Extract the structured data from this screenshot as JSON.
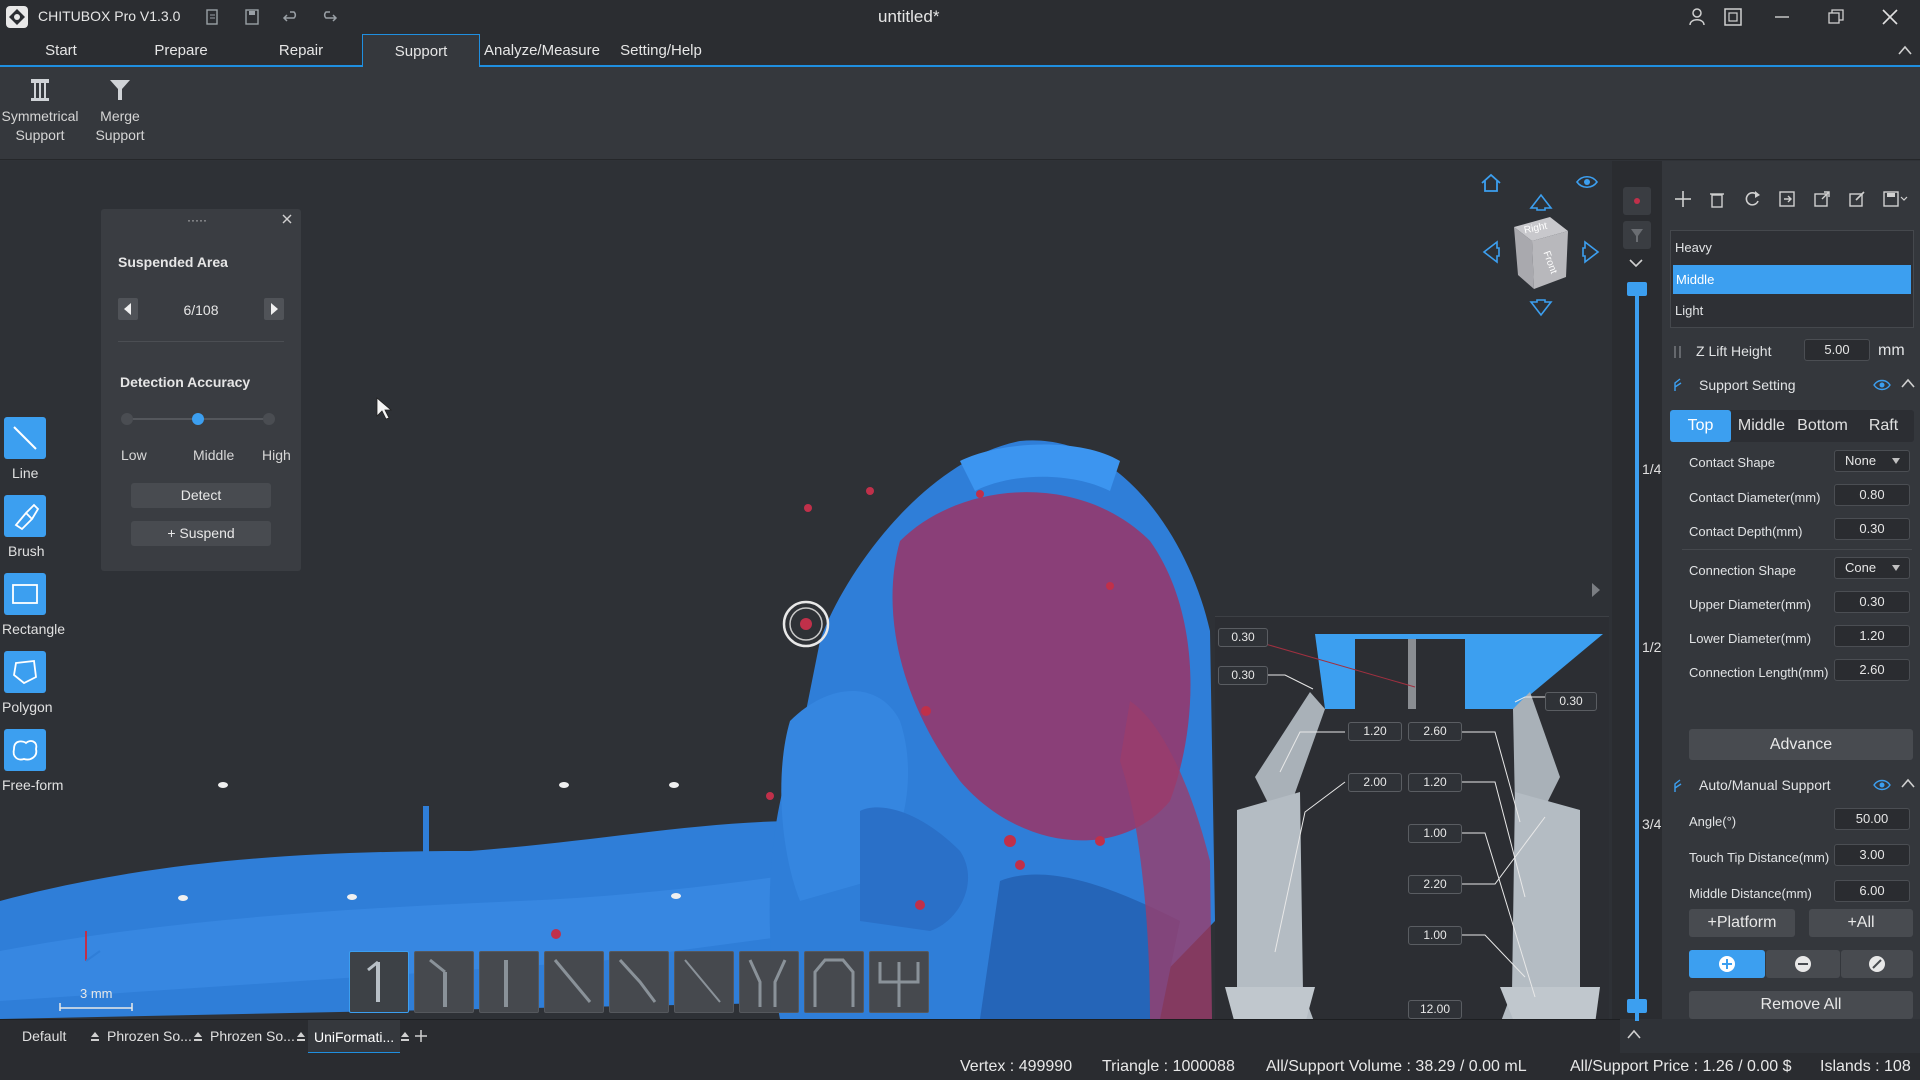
{
  "app": {
    "title": "CHITUBOX Pro V1.3.0",
    "file": "untitled*"
  },
  "menu": [
    "Start",
    "Prepare",
    "Repair",
    "Support",
    "Analyze/Measure",
    "Setting/Help"
  ],
  "ribbon": {
    "symmetrical": "Symmetrical\nSupport",
    "merge": "Merge\nSupport"
  },
  "tools": [
    "Line",
    "Brush",
    "Rectangle",
    "Polygon",
    "Free-form"
  ],
  "suspended": {
    "title": "Suspended Area",
    "counter": "6/108",
    "detection_title": "Detection Accuracy",
    "levels": [
      "Low",
      "Middle",
      "High"
    ],
    "selected_level": "Middle",
    "detect": "Detect",
    "suspend": "+ Suspend"
  },
  "view_cube": {
    "face_right": "Right",
    "face_front": "Front"
  },
  "scale": "3 mm",
  "slider_marks": [
    "1/4",
    "1/2",
    "3/4"
  ],
  "preview_values": {
    "top_left_1": "0.30",
    "top_left_2": "0.30",
    "top_right": "0.30",
    "upper_a": "1.20",
    "upper_b": "2.60",
    "mid_a": "2.00",
    "mid_b": "1.20",
    "v1": "1.00",
    "v2": "2.20",
    "v3": "1.00",
    "bottom": "12.00"
  },
  "presets": {
    "items": [
      "Heavy",
      "Middle",
      "Light"
    ],
    "selected": "Middle"
  },
  "zlift": {
    "label": "Z Lift Height",
    "value": "5.00",
    "unit": "mm"
  },
  "support_setting": {
    "title": "Support Setting",
    "tabs": [
      "Top",
      "Middle",
      "Bottom",
      "Raft"
    ],
    "active_tab": "Top",
    "contact_shape": {
      "label": "Contact Shape",
      "value": "None"
    },
    "contact_diameter": {
      "label": "Contact Diameter(mm)",
      "value": "0.80"
    },
    "contact_depth": {
      "label": "Contact Depth(mm)",
      "value": "0.30"
    },
    "connection_shape": {
      "label": "Connection Shape",
      "value": "Cone"
    },
    "upper_diameter": {
      "label": "Upper Diameter(mm)",
      "value": "0.30"
    },
    "lower_diameter": {
      "label": "Lower Diameter(mm)",
      "value": "1.20"
    },
    "connection_length": {
      "label": "Connection Length(mm)",
      "value": "2.60"
    },
    "advance": "Advance"
  },
  "auto_manual": {
    "title": "Auto/Manual Support",
    "angle": {
      "label": "Angle(°)",
      "value": "50.00"
    },
    "touch_tip": {
      "label": "Touch Tip Distance(mm)",
      "value": "3.00"
    },
    "middle_distance": {
      "label": "Middle Distance(mm)",
      "value": "6.00"
    },
    "platform": "+Platform",
    "all": "+All",
    "remove_all": "Remove All"
  },
  "tabs_bottom": [
    "Default",
    "Phrozen So...",
    "Phrozen So...",
    "UniFormati..."
  ],
  "status": {
    "vertex": "Vertex : 499990",
    "triangle": "Triangle : 1000088",
    "volume": "All/Support Volume : 38.29 / 0.00 mL",
    "price": "All/Support Price : 1.26 / 0.00 $",
    "islands": "Islands : 108"
  },
  "colors": {
    "accent": "#1f8fe0",
    "model": "#2f7ed8",
    "suspended": "#c0304a"
  }
}
